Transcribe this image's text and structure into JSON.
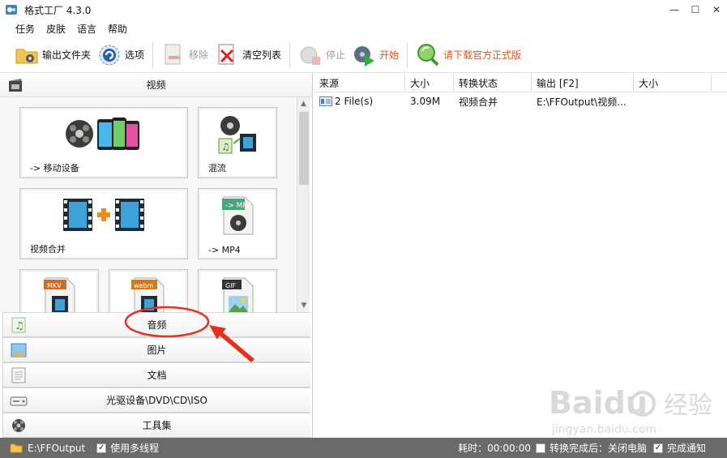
{
  "window": {
    "title": "格式工厂 4.3.0",
    "minimize": "—",
    "maximize": "☐",
    "close": "✕"
  },
  "menu": [
    "任务",
    "皮肤",
    "语言",
    "帮助"
  ],
  "toolbar": {
    "output_folder": "输出文件夹",
    "options": "选项",
    "remove": "移除",
    "clear_list": "清空列表",
    "stop": "停止",
    "start": "开始",
    "download": "请下载官方正式版"
  },
  "video": {
    "header": "视频",
    "tiles": {
      "mobile": "-> 移动设备",
      "mux": "混流",
      "merge": "视频合并",
      "mp4": "-> MP4",
      "mkv": "MKV",
      "webm": "webm",
      "gif": "GIF"
    }
  },
  "categories": [
    "音频",
    "图片",
    "文档",
    "光驱设备\\DVD\\CD\\ISO",
    "工具集"
  ],
  "tasks": {
    "columns": [
      "来源",
      "大小",
      "转换状态",
      "输出 [F2]",
      "大小"
    ],
    "rows": [
      {
        "source": "2 File(s)",
        "size": "3.09M",
        "status": "视频合并",
        "output": "E:\\FFOutput\\视频...",
        "out_size": ""
      }
    ]
  },
  "status": {
    "output_path": "E:\\FFOutput",
    "multithread": "使用多线程",
    "elapsed": "耗时：00:00:00",
    "after": "转换完成后：关闭电脑",
    "notify": "完成通知"
  },
  "watermark": {
    "brand": "Baidu",
    "cn": "经验",
    "url": "jingyan.baidu.com"
  },
  "colors": {
    "accent_orange": "#e0531c",
    "annotation_red": "#e8301f",
    "statusbar": "#6a6a6a"
  }
}
